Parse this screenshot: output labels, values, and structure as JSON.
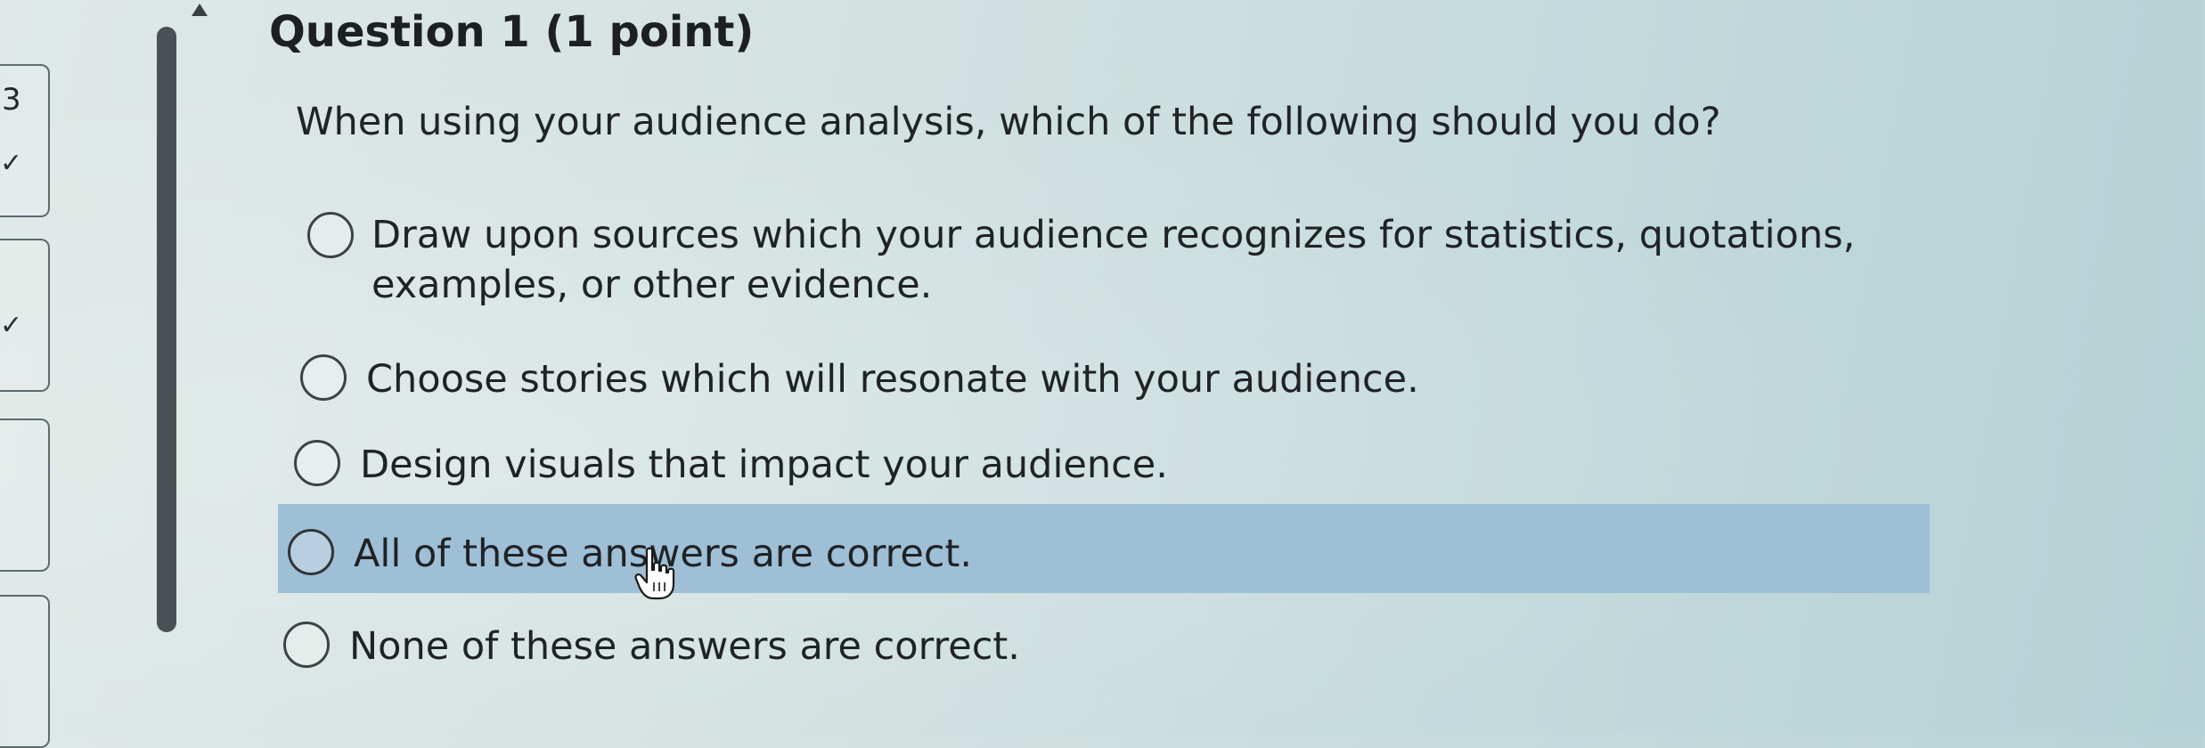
{
  "nav": {
    "items": [
      {
        "number": "3",
        "state": "answered"
      },
      {
        "number": "",
        "state": "answered"
      },
      {
        "number": "",
        "state": "unanswered"
      },
      {
        "number": "",
        "state": "unanswered"
      }
    ]
  },
  "question": {
    "title": "Question 1 (1 point)",
    "text": "When using your audience analysis, which of the following should you do?",
    "hovered_option_index": 3,
    "options": [
      {
        "label": "Draw upon sources which your audience recognizes for statistics, quotations, examples, or other evidence."
      },
      {
        "label": "Choose stories which will resonate with your audience."
      },
      {
        "label": "Design visuals that impact your audience."
      },
      {
        "label": "All of these answers are correct."
      },
      {
        "label": "None of these answers are correct."
      }
    ]
  },
  "colors": {
    "hover_highlight": "#9fbfd6",
    "scrollbar": "#4a5054"
  },
  "icons": {
    "cursor": "hand-pointer-icon",
    "check": "check-icon"
  }
}
